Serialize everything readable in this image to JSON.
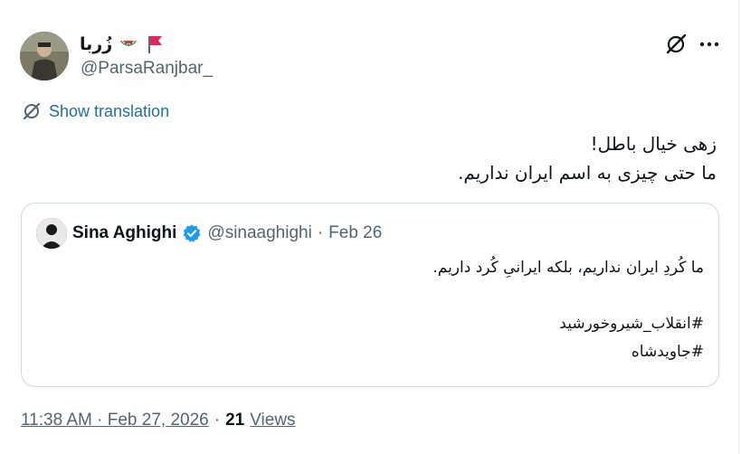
{
  "author": {
    "display_name": "زُربا",
    "flag_emoji": "flag",
    "watermelon_emoji": "watermelon",
    "handle": "@ParsaRanjbar_"
  },
  "translate": {
    "label": "Show translation",
    "color": "#1d6fa5"
  },
  "tweet": {
    "lines": [
      "زهی خیال باطل!",
      "ما حتی چیزی به اسم ایران نداریم."
    ]
  },
  "quote": {
    "name": "Sina Aghighi",
    "handle": "@sinaaghighi",
    "dot": "·",
    "date": "Feb 26",
    "verified_color": "#1d9bf0",
    "lines": [
      "ما کُردِ ایران نداریم، بلکه ایرانیِ کُرد داریم.",
      "",
      "#انقلاب_شیروخورشید",
      "#جاویدشاه"
    ]
  },
  "meta": {
    "timestamp": "11:38 AM · Feb 27, 2026",
    "dot": "·",
    "views_count": "21",
    "views_label": "Views"
  },
  "colors": {
    "text": "#0f1419",
    "secondary": "#536471",
    "border": "#cfd9de"
  }
}
